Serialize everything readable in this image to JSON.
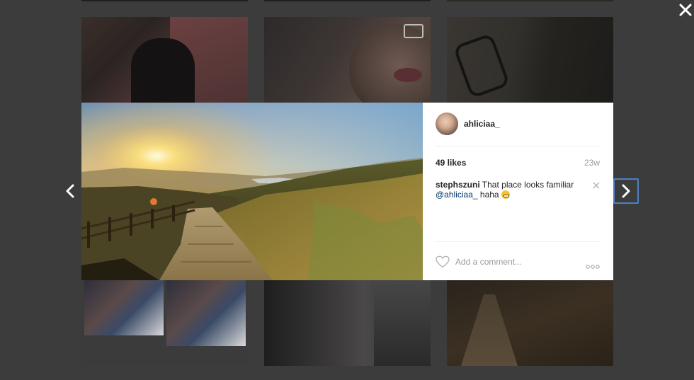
{
  "background_grid": {
    "tiles": [
      "photo",
      "video",
      "photo",
      "collage",
      "photo",
      "photo"
    ]
  },
  "modal": {
    "post": {
      "username": "ahliciaa_",
      "likes_text": "49 likes",
      "age": "23w",
      "comments": [
        {
          "user": "stephszuni",
          "text_before": "That place looks familiar",
          "mention": "@ahliciaa_",
          "text_after": "haha",
          "emoji": "grinning-emoji"
        }
      ],
      "add_comment_placeholder": "Add a comment..."
    }
  },
  "icons": {
    "close": "close-icon",
    "prev": "chevron-left-icon",
    "next": "chevron-right-icon",
    "like": "heart-icon",
    "more": "ellipsis-icon",
    "delete_comment": "close-small-icon",
    "video_badge": "video-camera-icon"
  },
  "colors": {
    "overlay": "#3c3c3c",
    "panel": "#ffffff",
    "text": "#262626",
    "muted": "#999999",
    "mention": "#003569",
    "focus_ring": "#4a82c4"
  }
}
